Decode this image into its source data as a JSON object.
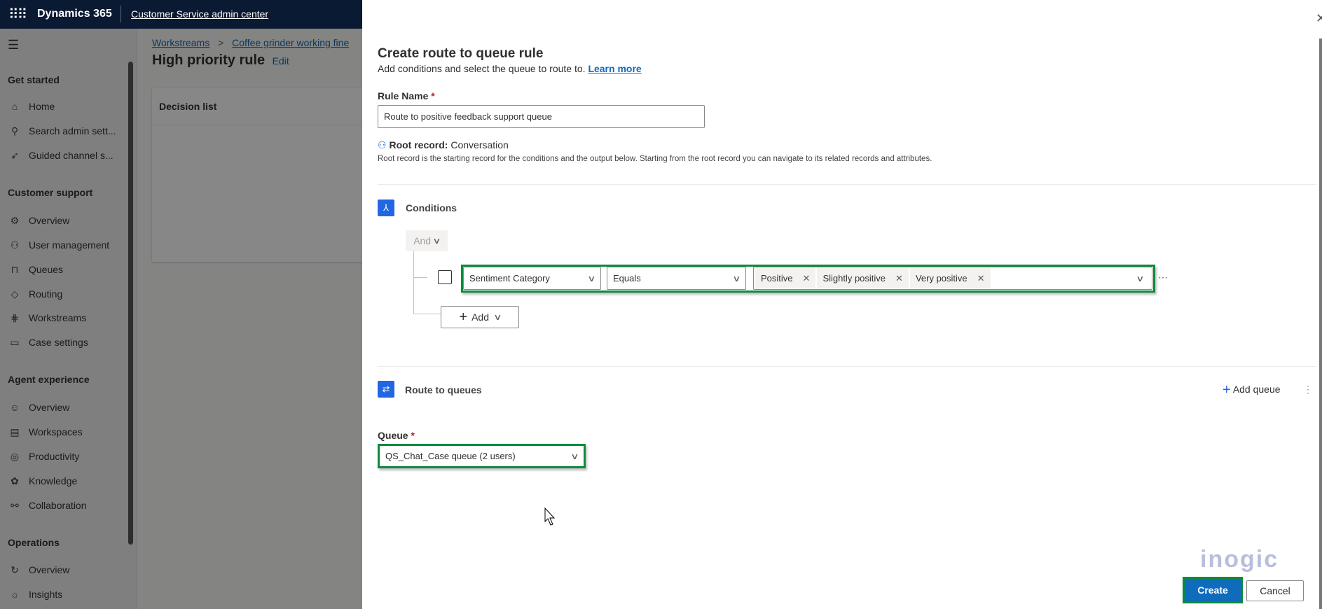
{
  "topbar": {
    "app_name": "Dynamics 365",
    "area_name": "Customer Service admin center"
  },
  "sidebar": {
    "sections": [
      {
        "heading": "Get started",
        "items": [
          {
            "label": "Home",
            "icon": "home-icon"
          },
          {
            "label": "Search admin sett...",
            "icon": "search-icon"
          },
          {
            "label": "Guided channel s...",
            "icon": "rocket-icon"
          }
        ]
      },
      {
        "heading": "Customer support",
        "items": [
          {
            "label": "Overview",
            "icon": "overview-icon"
          },
          {
            "label": "User management",
            "icon": "users-icon"
          },
          {
            "label": "Queues",
            "icon": "queue-icon"
          },
          {
            "label": "Routing",
            "icon": "routing-icon"
          },
          {
            "label": "Workstreams",
            "icon": "workstreams-icon"
          },
          {
            "label": "Case settings",
            "icon": "briefcase-icon"
          }
        ]
      },
      {
        "heading": "Agent experience",
        "items": [
          {
            "label": "Overview",
            "icon": "agent-icon"
          },
          {
            "label": "Workspaces",
            "icon": "workspaces-icon"
          },
          {
            "label": "Productivity",
            "icon": "productivity-icon"
          },
          {
            "label": "Knowledge",
            "icon": "knowledge-icon"
          },
          {
            "label": "Collaboration",
            "icon": "collaboration-icon"
          }
        ]
      },
      {
        "heading": "Operations",
        "items": [
          {
            "label": "Overview",
            "icon": "operations-icon"
          },
          {
            "label": "Insights",
            "icon": "lightbulb-icon"
          }
        ]
      }
    ]
  },
  "main": {
    "breadcrumb": [
      "Workstreams",
      "Coffee grinder working fine"
    ],
    "breadcrumb_sep": ">",
    "title": "High priority rule",
    "edit_label": "Edit",
    "card_title": "Decision list"
  },
  "panel": {
    "title": "Create route to queue rule",
    "subtitle": "Add conditions and select the queue to route to.",
    "learn_more": "Learn more",
    "rule_name_label": "Rule Name",
    "required_mark": "*",
    "rule_name_value": "Route to positive feedback support queue",
    "root_record_label": "Root record:",
    "root_record_value": "Conversation",
    "root_record_desc": "Root record is the starting record for the conditions and the output below. Starting from the root record you can navigate to its related records and attributes.",
    "conditions_label": "Conditions",
    "group_operator": "And",
    "condition": {
      "attribute": "Sentiment Category",
      "operator": "Equals",
      "values": [
        "Positive",
        "Slightly positive",
        "Very positive"
      ]
    },
    "add_label": "Add",
    "route_label": "Route to queues",
    "add_queue_label": "Add queue",
    "queue_label": "Queue",
    "queue_value": "QS_Chat_Case queue (2 users)",
    "create_label": "Create",
    "cancel_label": "Cancel",
    "watermark": "inogic"
  },
  "colors": {
    "accent": "#0f6cbd",
    "highlight": "#0e8a3c",
    "topbar": "#0b1a33"
  }
}
